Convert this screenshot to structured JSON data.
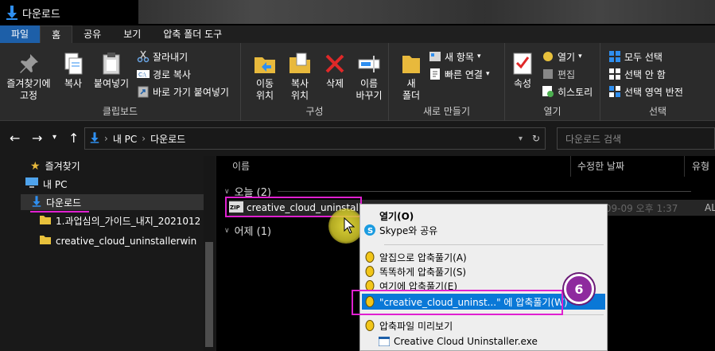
{
  "window": {
    "title": "다운로드"
  },
  "ribbon_tabs": [
    "파일",
    "홈",
    "공유",
    "보기",
    "압축 폴더 도구"
  ],
  "ribbon": {
    "clipboard": {
      "label": "클립보드",
      "pin": "즐겨찾기에\n고정",
      "copy": "복사",
      "paste": "붙여넣기",
      "cut": "잘라내기",
      "copy_path": "경로 복사",
      "paste_shortcut": "바로 가기 붙여넣기"
    },
    "organize": {
      "label": "구성",
      "move_to": "이동\n위치",
      "copy_to": "복사\n위치",
      "delete": "삭제",
      "rename": "이름\n바꾸기"
    },
    "new": {
      "label": "새로 만들기",
      "new_folder": "새\n폴더",
      "new_item": "새 항목",
      "easy_access": "빠른 연결"
    },
    "open": {
      "label": "열기",
      "properties": "속성",
      "open": "열기",
      "edit": "편집",
      "history": "히스토리"
    },
    "select": {
      "label": "선택",
      "select_all": "모두 선택",
      "select_none": "선택 안 함",
      "invert": "선택 영역 반전"
    }
  },
  "address": {
    "path": [
      "내 PC",
      "다운로드"
    ],
    "search_placeholder": "다운로드 검색"
  },
  "nav": {
    "favorites": "즐겨찾기",
    "this_pc": "내 PC",
    "downloads": "다운로드",
    "folder1": "1.과업심의_가이드_내지_2021012",
    "folder2": "creative_cloud_uninstallerwin"
  },
  "columns": {
    "name": "이름",
    "modified": "수정한 날짜",
    "type": "유형"
  },
  "groups": {
    "today": "오늘 (2)",
    "yesterday": "어제 (1)"
  },
  "file": {
    "name": "creative_cloud_uninstaller",
    "date": "2021-09-09 오후 1:37",
    "type": "ALZip"
  },
  "context_menu": {
    "open": "열기(O)",
    "skype": "Skype와 공유",
    "alzip_extract": "알집으로 압축풀기(A)",
    "smart_extract": "똑똑하게 압축풀기(S)",
    "extract_here": "여기에 압축풀기(E)",
    "extract_to": "\"creative_cloud_uninst...\" 에 압축풀기(W)",
    "preview": "압축파일 미리보기",
    "exe": "Creative Cloud Uninstaller.exe"
  },
  "step_badge": "6",
  "colors": {
    "accent": "#0a78d7",
    "annotation": "#e020d0",
    "badge": "#8e2a9e"
  }
}
